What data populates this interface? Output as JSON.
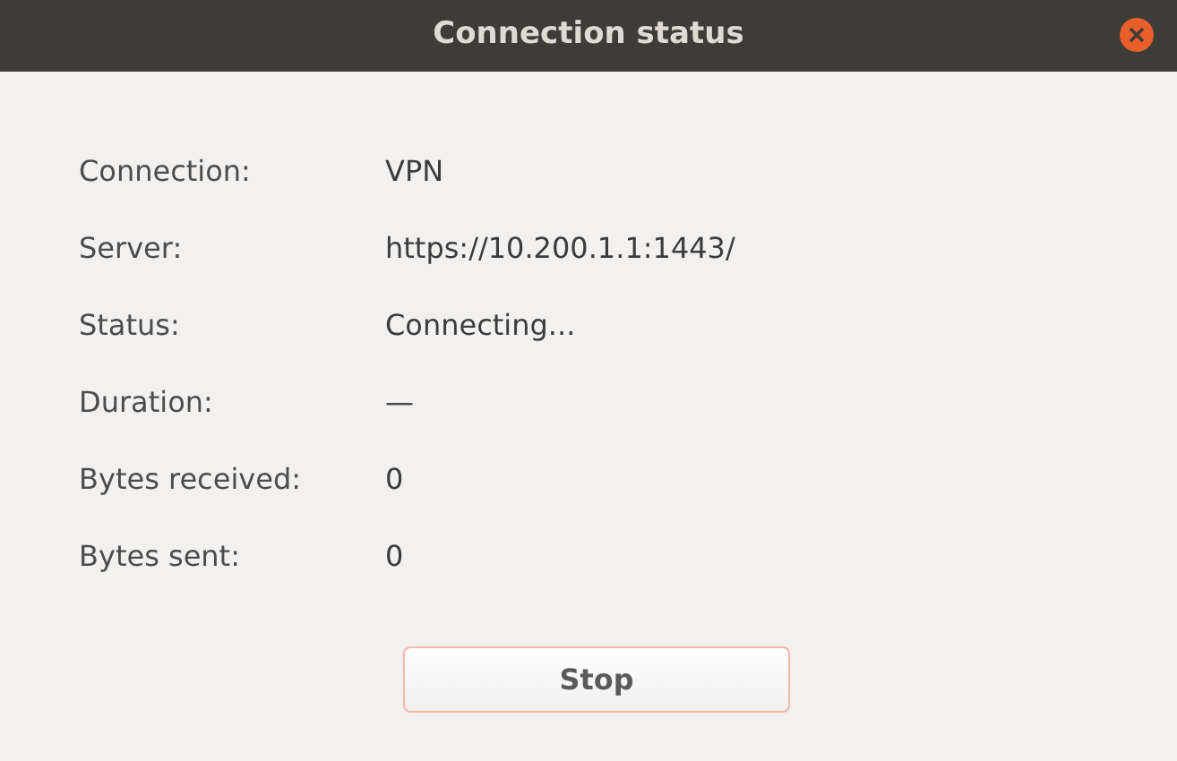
{
  "window": {
    "title": "Connection status"
  },
  "fields": [
    {
      "label": "Connection:",
      "value": "VPN"
    },
    {
      "label": "Server:",
      "value": "https://10.200.1.1:1443/"
    },
    {
      "label": "Status:",
      "value": "Connecting..."
    },
    {
      "label": "Duration:",
      "value": "—"
    },
    {
      "label": "Bytes received:",
      "value": "0"
    },
    {
      "label": "Bytes sent:",
      "value": "0"
    }
  ],
  "buttons": [
    "Stop"
  ]
}
